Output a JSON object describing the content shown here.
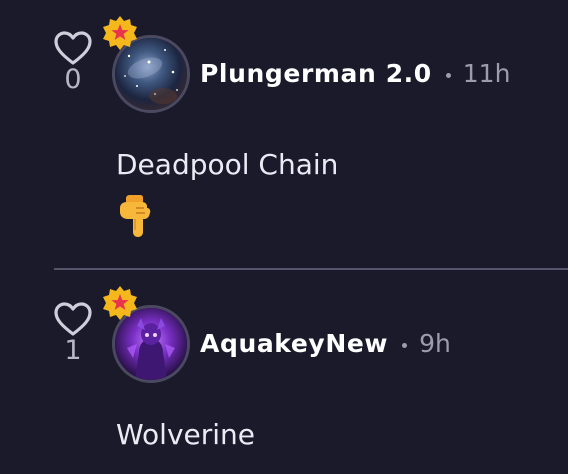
{
  "comments": [
    {
      "likes": "0",
      "username": "Plungerman 2.0",
      "time": "11h",
      "text": "Deadpool Chain",
      "emoji_icon": "pointing-down-hand-emoji",
      "avatar_icon": "galaxy-avatar",
      "badge_icon": "star-badge-icon"
    },
    {
      "likes": "1",
      "username": "AquakeyNew",
      "time": "9h",
      "text": "Wolverine",
      "avatar_icon": "purple-character-avatar",
      "badge_icon": "star-badge-icon"
    }
  ],
  "colors": {
    "background": "#1b1a2b",
    "text": "#ffffff",
    "muted": "#9d9cab",
    "badge": "#f5b81c",
    "badge_star": "#e8344c"
  }
}
